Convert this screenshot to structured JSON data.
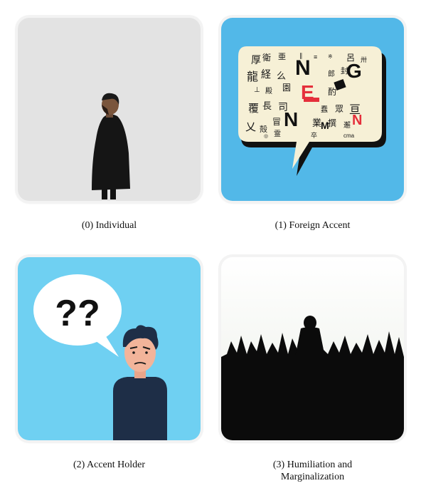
{
  "panels": [
    {
      "caption": "(0) Individual"
    },
    {
      "caption": "(1) Foreign Accent",
      "bubble_letters": [
        "N",
        "G",
        "E",
        "N",
        "M",
        "N"
      ]
    },
    {
      "caption": "(2) Accent Holder",
      "thought_marks": "??"
    },
    {
      "caption_line1": "(3) Humiliation and",
      "caption_line2": "Marginalization"
    }
  ],
  "colors": {
    "sky_blue": "#52b8e8",
    "light_blue": "#6fd0f2",
    "accent_red": "#e52f3b"
  }
}
